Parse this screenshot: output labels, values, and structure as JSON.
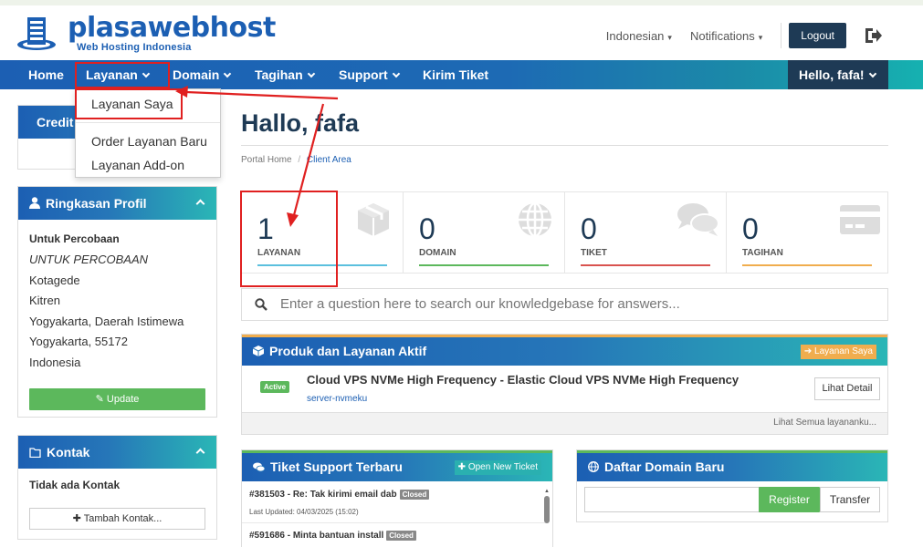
{
  "colors": {
    "brand": "#1c5fb3",
    "navy": "#1e3a55",
    "teal": "#16b1b0",
    "green": "#5cb85c",
    "orange": "#f0ad4e",
    "red_annotation": "#e02020"
  },
  "header": {
    "logo_name": "plasawebhost",
    "logo_tagline": "Web Hosting Indonesia",
    "language": "Indonesian",
    "notifications": "Notifications",
    "logout": "Logout",
    "exit_icon": "sign-out-icon"
  },
  "nav": {
    "items": [
      {
        "label": "Home"
      },
      {
        "label": "Layanan"
      },
      {
        "label": "Domain"
      },
      {
        "label": "Tagihan"
      },
      {
        "label": "Support"
      },
      {
        "label": "Kirim Tiket"
      }
    ],
    "user": "Hello, fafa!"
  },
  "dropdown": {
    "items": [
      "Layanan Saya",
      "Order Layanan Baru",
      "Layanan Add-on"
    ]
  },
  "sidebar": {
    "credit_title": "Credit",
    "profile": {
      "title": "Ringkasan Profil",
      "lines": [
        "Untuk Percobaan",
        "UNTUK PERCOBAAN",
        "Kotagede",
        "Kitren",
        "Yogyakarta, Daerah Istimewa",
        "Yogyakarta, 55172",
        "Indonesia"
      ],
      "update_button": "Update"
    },
    "contacts": {
      "title": "Kontak",
      "empty_text": "Tidak ada Kontak",
      "add_button": "Tambah Kontak..."
    }
  },
  "main": {
    "greeting": "Hallo, fafa",
    "breadcrumb": {
      "home": "Portal Home",
      "sep": "/",
      "current": "Client Area"
    },
    "stats": [
      {
        "value": "1",
        "label": "LAYANAN",
        "color": "#5bc0de",
        "icon": "cube-icon"
      },
      {
        "value": "0",
        "label": "DOMAIN",
        "color": "#5cb85c",
        "icon": "globe-icon"
      },
      {
        "value": "0",
        "label": "TIKET",
        "color": "#d9534f",
        "icon": "comments-icon"
      },
      {
        "value": "0",
        "label": "TAGIHAN",
        "color": "#f0ad4e",
        "icon": "credit-card-icon"
      }
    ],
    "search_placeholder": "Enter a question here to search our knowledgebase for answers...",
    "products": {
      "title": "Produk dan Layanan Aktif",
      "header_button": "Layanan Saya",
      "status": "Active",
      "product_name": "Cloud VPS NVMe High Frequency - Elastic Cloud VPS NVMe High Frequency",
      "product_domain": "server-nvmeku",
      "detail_button": "Lihat Detail",
      "footer": "Lihat Semua layananku..."
    },
    "tickets": {
      "title": "Tiket Support Terbaru",
      "header_button": "Open New Ticket",
      "rows": [
        {
          "subject": "#381503 - Re: Tak kirimi email dab",
          "status": "Closed",
          "updated": "Last Updated: 04/03/2025 (15:02)"
        },
        {
          "subject": "#591686 - Minta bantuan install",
          "status": "Closed"
        }
      ]
    },
    "domains": {
      "title": "Daftar Domain Baru",
      "register": "Register",
      "transfer": "Transfer"
    }
  }
}
